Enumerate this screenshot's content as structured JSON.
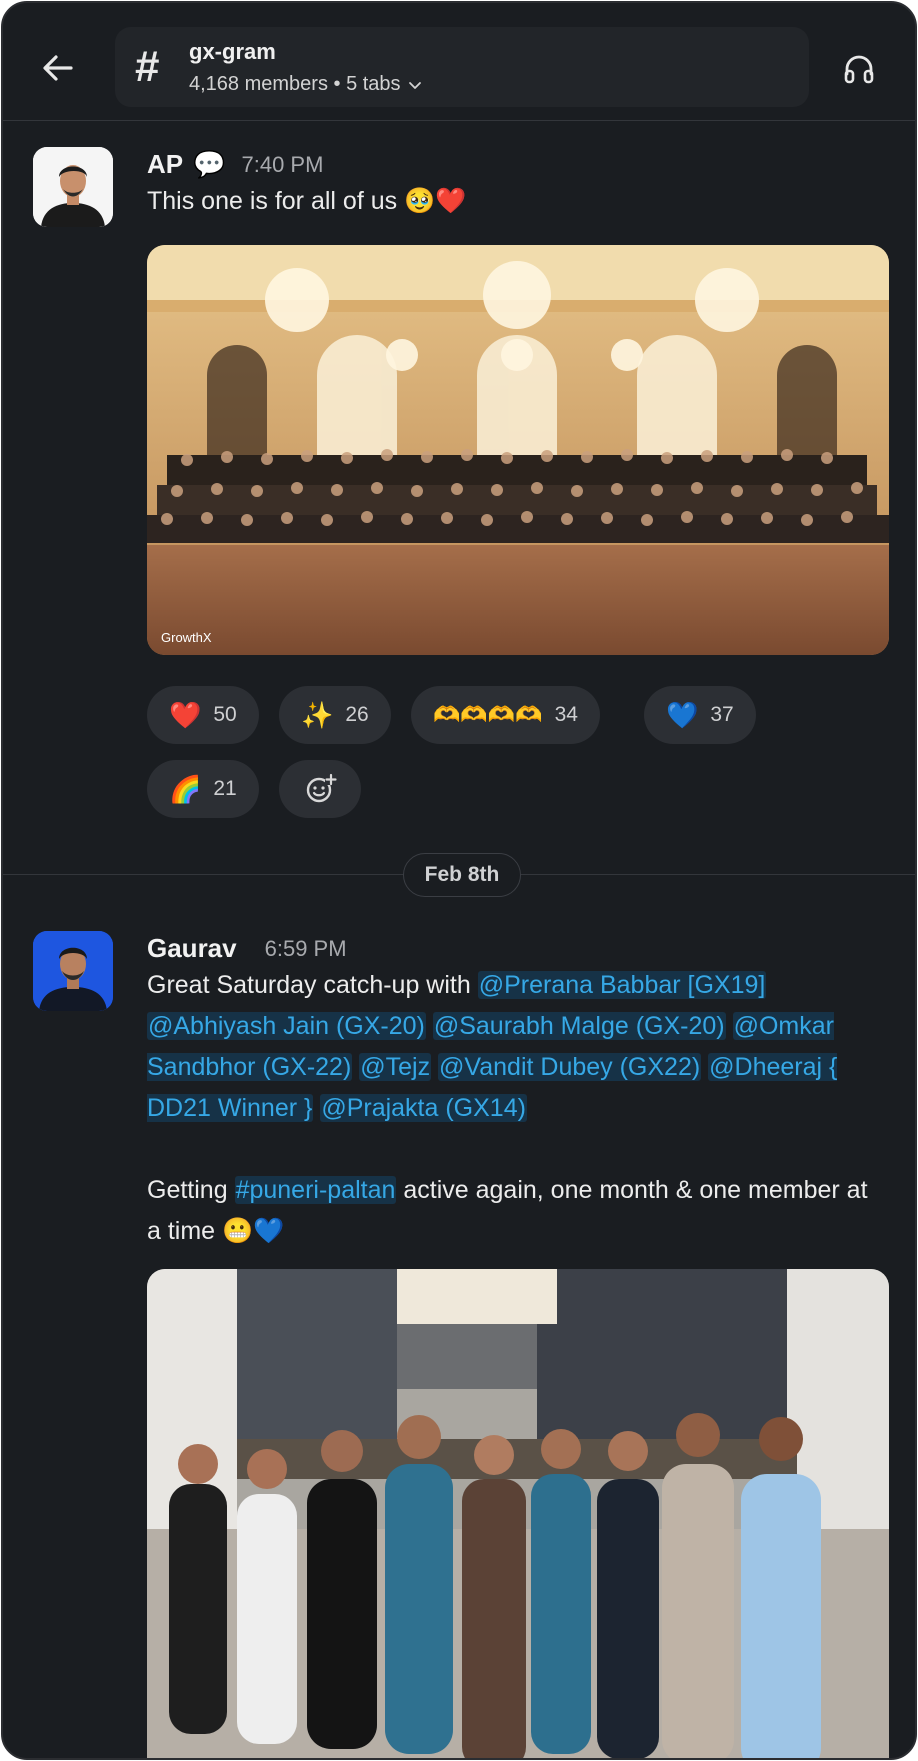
{
  "header": {
    "channel_name": "gx-gram",
    "channel_meta": "4,168 members • 5 tabs",
    "hash_symbol": "#"
  },
  "messages": [
    {
      "sender": "AP",
      "time": "7:40 PM",
      "text": "This one is for all of us 🥹❤️",
      "status_emoji": "💬",
      "photo_watermark": "GrowthX",
      "reactions": [
        {
          "emoji": "❤️",
          "count": "50"
        },
        {
          "emoji": "✨",
          "count": "26"
        },
        {
          "emoji": "🫶🫶🫶🫶",
          "count": "34"
        },
        {
          "emoji": "💙",
          "count": "37"
        },
        {
          "emoji": "🌈",
          "count": "21"
        }
      ]
    },
    {
      "sender": "Gaurav",
      "time": "6:59 PM",
      "intro": "Great Saturday catch-up with ",
      "mentions": [
        "@Prerana Babbar [GX19]",
        "@Abhiyash Jain (GX-20)",
        "@Saurabh Malge (GX-20)",
        "@Omkar Sandbhor (GX-22)",
        "@Tejz",
        "@Vandit Dubey (GX22)",
        "@Dheeraj { DD21 Winner }",
        "@Prajakta (GX14)"
      ],
      "line2_pre": "Getting ",
      "channel_link": "#puneri-paltan",
      "line2_post": " active again, one month & one member at a time 😬💙"
    }
  ],
  "date_divider": "Feb 8th",
  "icons": {
    "back": "arrow-left-icon",
    "headphones": "headphones-icon",
    "add_reaction": "add-reaction-icon",
    "chevron": "chevron-down-icon"
  }
}
